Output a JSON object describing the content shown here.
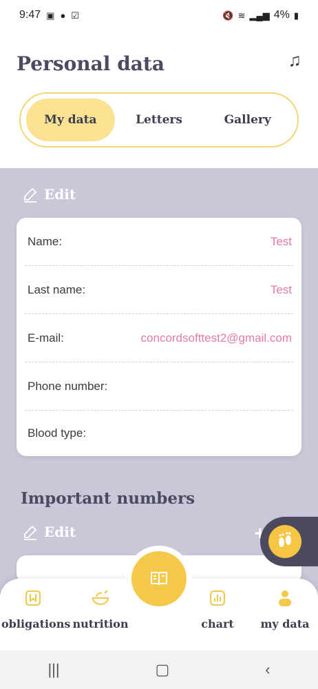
{
  "status": {
    "time": "9:47",
    "battery": "4%",
    "icons_left": [
      "gallery-icon",
      "bulb-icon",
      "check-icon"
    ],
    "icons_right": [
      "mute-icon",
      "wifi-icon",
      "signal-icon",
      "battery-icon"
    ]
  },
  "header": {
    "title": "Personal data",
    "music_icon": "music-note-icon"
  },
  "tabs": [
    {
      "label": "My data",
      "active": true
    },
    {
      "label": "Letters",
      "active": false
    },
    {
      "label": "Gallery",
      "active": false
    }
  ],
  "edit_label": "Edit",
  "personal_card": {
    "rows": [
      {
        "label": "Name:",
        "value": "Test"
      },
      {
        "label": "Last name:",
        "value": "Test"
      },
      {
        "label": "E-mail:",
        "value": "concordsofttest2@gmail.com"
      },
      {
        "label": "Phone number:",
        "value": ""
      },
      {
        "label": "Blood type:",
        "value": ""
      }
    ]
  },
  "important": {
    "title": "Important numbers",
    "edit_label": "Edit",
    "add_label": "+"
  },
  "nav": {
    "items": [
      {
        "label": "obligations",
        "icon": "bookmark-icon"
      },
      {
        "label": "nutrition",
        "icon": "bowl-icon"
      },
      {
        "label": "chart",
        "icon": "bar-chart-icon"
      },
      {
        "label": "my data",
        "icon": "person-icon"
      }
    ],
    "center_icon": "book-icon"
  },
  "colors": {
    "accent_yellow": "#f6c84a",
    "tab_active": "#fbe293",
    "panel_bg": "#c9c7d8",
    "value_pink": "#e27aa8",
    "title_dark": "#4a4a60"
  }
}
